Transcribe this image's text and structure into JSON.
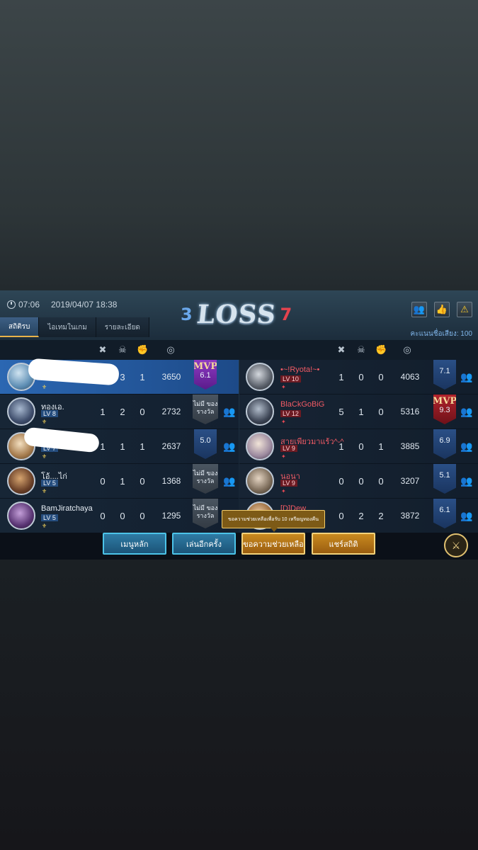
{
  "header": {
    "time": "07:06",
    "datetime": "2019/04/07 18:38",
    "score_blue": "3",
    "result": "LOSS",
    "score_red": "7",
    "voice_label": "คะแนนชื่อเสียง: 100",
    "tabs": [
      "สถิติรบ",
      "ไอเทมในเกม",
      "รายละเอียด"
    ]
  },
  "columns": {
    "kill_icon": "crossed-swords-icon",
    "death_icon": "skull-icon",
    "assist_icon": "fist-icon",
    "gold_icon": "coins-icon"
  },
  "left_team": [
    {
      "name": "",
      "level": "",
      "kills": "",
      "deaths": "3",
      "assists": "1",
      "gold": "3650",
      "rating": "6.1",
      "mvp": "MVP",
      "me": true
    },
    {
      "name": "ทองเอ.",
      "level": "LV 8",
      "kills": "1",
      "deaths": "2",
      "assists": "0",
      "gold": "2732",
      "no_award": "ไม่มี ของรางวัล"
    },
    {
      "name": "",
      "level": "LV 7",
      "kills": "1",
      "deaths": "1",
      "assists": "1",
      "gold": "2637",
      "rating": "5.0"
    },
    {
      "name": "โอ้....ไก่",
      "level": "LV 5",
      "kills": "0",
      "deaths": "1",
      "assists": "0",
      "gold": "1368",
      "no_award": "ไม่มี ของรางวัล"
    },
    {
      "name": "BamJiratchaya",
      "level": "LV 5",
      "kills": "0",
      "deaths": "0",
      "assists": "0",
      "gold": "1295",
      "no_award": "ไม่มี ของรางวัล"
    }
  ],
  "right_team": [
    {
      "name": "•~!Ryota!~•",
      "level": "LV 10",
      "kills": "1",
      "deaths": "0",
      "assists": "0",
      "gold": "4063",
      "rating": "7.1"
    },
    {
      "name": "BlaCkGoBiG",
      "level": "LV 12",
      "kills": "5",
      "deaths": "1",
      "assists": "0",
      "gold": "5316",
      "rating": "9.3",
      "mvp": "MVP"
    },
    {
      "name": "สายเพียวมาแร้ว^-^",
      "level": "LV 9",
      "kills": "1",
      "deaths": "0",
      "assists": "1",
      "gold": "3885",
      "rating": "6.9"
    },
    {
      "name": "นอนา",
      "level": "LV 9",
      "kills": "0",
      "deaths": "0",
      "assists": "0",
      "gold": "3207",
      "rating": "5.1"
    },
    {
      "name": "[D]Dew",
      "level": "",
      "kills": "0",
      "deaths": "2",
      "assists": "2",
      "gold": "3872",
      "rating": "6.1"
    }
  ],
  "buttons": {
    "main_menu": "เมนูหลัก",
    "play_again": "เล่นอีกครั้ง",
    "ask_help": "ขอความช่วยเหลือ",
    "share": "แชร์สถิติ"
  },
  "tooltip": "ขอความช่วยเหลือเพื่อรับ 10 เหรียญทองคืน",
  "colors": {
    "blue_accent": "#2b67b2",
    "red_accent": "#e4434e",
    "gold_accent": "#f3d27a"
  }
}
